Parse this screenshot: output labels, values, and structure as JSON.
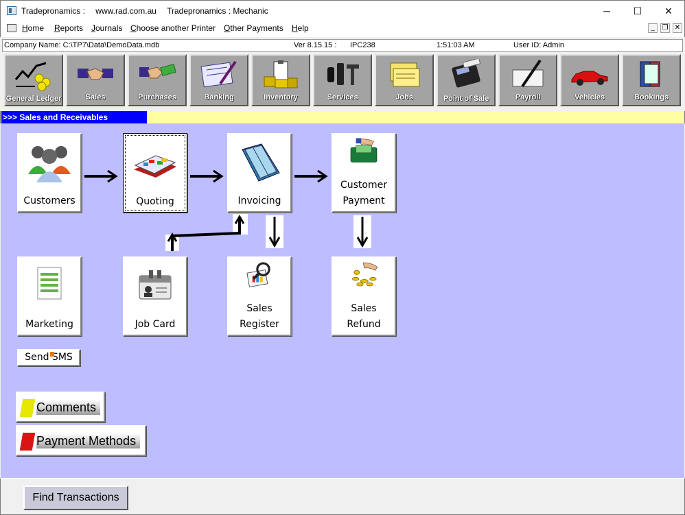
{
  "window": {
    "title_parts": [
      "Tradepronamics :",
      "www.rad.com.au",
      "Tradepronamics : Mechanic"
    ],
    "minimize": "─",
    "maximize": "☐",
    "close": "✕"
  },
  "menu": [
    "Home",
    "Reports",
    "Journals",
    "Choose another Printer",
    "Other Payments",
    "Help"
  ],
  "mdi_controls": [
    "_",
    "❐",
    "✕"
  ],
  "status": {
    "company": "Company Name: C:\\TP7\\Data\\DemoData.mdb",
    "version": "Ver 8.15.15  :",
    "machine": "IPC238",
    "time": "1:51:03 AM",
    "user": "User ID: Admin"
  },
  "toolbar": [
    {
      "label": "General Ledger",
      "icon": "ledger-chart-icon"
    },
    {
      "label": "Sales",
      "icon": "handshake-icon"
    },
    {
      "label": "Purchases",
      "icon": "handshake-money-icon"
    },
    {
      "label": "Banking",
      "icon": "cheque-pen-icon"
    },
    {
      "label": "Inventory",
      "icon": "clipboard-boxes-icon"
    },
    {
      "label": "Services",
      "icon": "tools-icon"
    },
    {
      "label": "Jobs",
      "icon": "cards-icon"
    },
    {
      "label": "Point of Sale",
      "icon": "card-terminal-icon"
    },
    {
      "label": "Payroll",
      "icon": "pen-cheque-icon"
    },
    {
      "label": "Vehicles",
      "icon": "red-car-icon"
    },
    {
      "label": "Bookings",
      "icon": "books-icon"
    }
  ],
  "section_title": ">>>  Sales and Receivables",
  "tiles": [
    {
      "label": "Customers",
      "icon": "people-icon"
    },
    {
      "label": "Quoting",
      "icon": "quote-book-icon"
    },
    {
      "label": "Invoicing",
      "icon": "open-book-icon"
    },
    {
      "label": "Customer\nPayment",
      "icon": "wallet-money-icon"
    },
    {
      "label": "Marketing",
      "icon": "spreadsheet-icon"
    },
    {
      "label": "Job Card",
      "icon": "id-card-icon"
    },
    {
      "label": "Sales\nRegister",
      "icon": "magnifier-register-icon"
    },
    {
      "label": "Sales\nRefund",
      "icon": "coins-hand-icon"
    }
  ],
  "send_sms": "Send SMS",
  "comments": "Comments",
  "payment_methods": "Payment Methods",
  "find_transactions": "Find Transactions",
  "colors": {
    "main_bg": "#bdbdff",
    "section_blue": "#0000ff",
    "section_yellow": "#ffff9f",
    "comments_swatch": "#e6e600",
    "payment_swatch": "#d81414"
  }
}
